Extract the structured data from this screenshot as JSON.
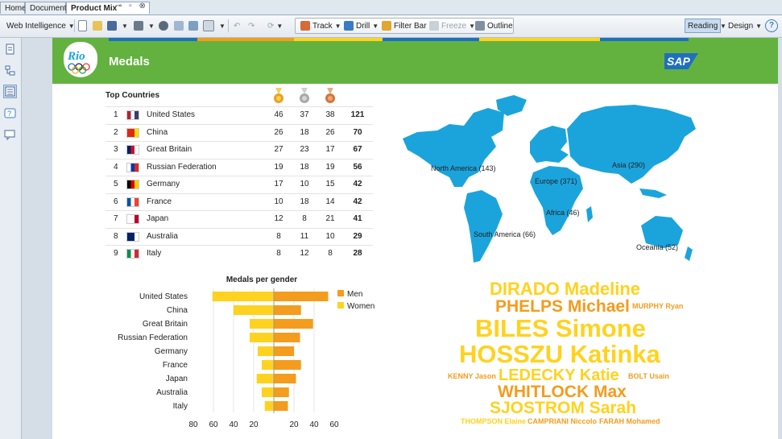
{
  "tabs": [
    {
      "label": "Home",
      "active": false
    },
    {
      "label": "Documents",
      "active": false
    },
    {
      "label": "Product Mix",
      "active": true
    }
  ],
  "toolbar": {
    "app_menu": "Web Intelligence",
    "track": "Track",
    "drill": "Drill",
    "filter_bar": "Filter Bar",
    "freeze": "Freeze",
    "outline": "Outline",
    "reading": "Reading",
    "design": "Design",
    "help": "?"
  },
  "header": {
    "title": "Medals",
    "logo_text": "Rio",
    "brand": "SAP",
    "colors": {
      "banner": "#63b23f",
      "brand": "#1f6fc0"
    }
  },
  "top_countries": {
    "title": "Top Countries",
    "medal_icons": [
      "gold-medal-icon",
      "silver-medal-icon",
      "bronze-medal-icon"
    ],
    "rows": [
      {
        "rank": "1",
        "country": "United States",
        "gold": "46",
        "silver": "37",
        "bronze": "38",
        "total": "121"
      },
      {
        "rank": "2",
        "country": "China",
        "gold": "26",
        "silver": "18",
        "bronze": "26",
        "total": "70"
      },
      {
        "rank": "3",
        "country": "Great Britain",
        "gold": "27",
        "silver": "23",
        "bronze": "17",
        "total": "67"
      },
      {
        "rank": "4",
        "country": "Russian Federation",
        "gold": "19",
        "silver": "18",
        "bronze": "19",
        "total": "56"
      },
      {
        "rank": "5",
        "country": "Germany",
        "gold": "17",
        "silver": "10",
        "bronze": "15",
        "total": "42"
      },
      {
        "rank": "6",
        "country": "France",
        "gold": "10",
        "silver": "18",
        "bronze": "14",
        "total": "42"
      },
      {
        "rank": "7",
        "country": "Japan",
        "gold": "12",
        "silver": "8",
        "bronze": "21",
        "total": "41"
      },
      {
        "rank": "8",
        "country": "Australia",
        "gold": "8",
        "silver": "11",
        "bronze": "10",
        "total": "29"
      },
      {
        "rank": "9",
        "country": "Italy",
        "gold": "8",
        "silver": "12",
        "bronze": "8",
        "total": "28"
      }
    ]
  },
  "map": {
    "regions": [
      {
        "label": "North America (143)"
      },
      {
        "label": "Europe (371)"
      },
      {
        "label": "Asia (290)"
      },
      {
        "label": "Africa (46)"
      },
      {
        "label": "South America (66)"
      },
      {
        "label": "Oceania (52)"
      }
    ],
    "color": "#1ba4dc"
  },
  "chart_data": {
    "type": "bar",
    "title": "Medals per gender",
    "categories": [
      "United States",
      "China",
      "Great Britain",
      "Russian Federation",
      "Germany",
      "France",
      "Japan",
      "Australia",
      "Italy"
    ],
    "series": [
      {
        "name": "Men",
        "color": "#f39c1d",
        "values": [
          54,
          27,
          39,
          26,
          20,
          27,
          22,
          15,
          14
        ]
      },
      {
        "name": "Women",
        "color": "#ffd21f",
        "values": [
          61,
          40,
          24,
          24,
          16,
          12,
          17,
          12,
          9
        ]
      }
    ],
    "xticks": [
      "80",
      "60",
      "40",
      "20",
      "20",
      "40",
      "60"
    ],
    "xlim": [
      -80,
      60
    ],
    "legend": "right"
  },
  "word_cloud": [
    {
      "text": "DIRADO Madeline",
      "color": "#ffd21f"
    },
    {
      "text": "PHELPS Michael",
      "color": "#f39c1d"
    },
    {
      "text": "MURPHY Ryan",
      "color": "#f39c1d"
    },
    {
      "text": "BILES Simone",
      "color": "#ffd21f"
    },
    {
      "text": "HOSSZU Katinka",
      "color": "#ffd21f"
    },
    {
      "text": "KENNY Jason",
      "color": "#f39c1d"
    },
    {
      "text": "LEDECKY Katie",
      "color": "#ffd21f"
    },
    {
      "text": "BOLT Usain",
      "color": "#f39c1d"
    },
    {
      "text": "WHITLOCK Max",
      "color": "#f39c1d"
    },
    {
      "text": "SJOSTROM Sarah",
      "color": "#ffd21f"
    },
    {
      "text": "THOMPSON Elaine",
      "color": "#ffd21f"
    },
    {
      "text": "CAMPRIANI Niccolo",
      "color": "#f39c1d"
    },
    {
      "text": "FARAH Mohamed",
      "color": "#f39c1d"
    }
  ]
}
